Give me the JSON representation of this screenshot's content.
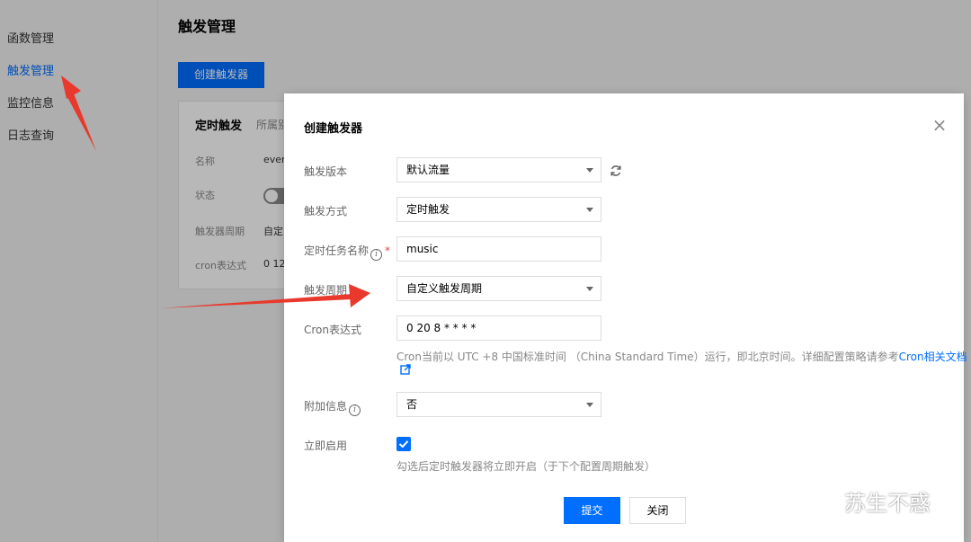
{
  "sidebar": {
    "items": [
      {
        "label": "函数管理",
        "active": false
      },
      {
        "label": "触发管理",
        "active": true
      },
      {
        "label": "监控信息",
        "active": false
      },
      {
        "label": "日志查询",
        "active": false
      }
    ]
  },
  "main": {
    "title": "触发管理",
    "create_button": "创建触发器",
    "card": {
      "title": "定时触发",
      "subtitle": "所属别",
      "rows": [
        {
          "label": "名称",
          "value": "ever"
        },
        {
          "label": "状态",
          "value": ""
        },
        {
          "label": "触发器周期",
          "value": "自定"
        },
        {
          "label": "cron表达式",
          "value": "0 12"
        }
      ]
    }
  },
  "modal": {
    "title": "创建触发器",
    "close_icon": "close-icon",
    "fields": {
      "version": {
        "label": "触发版本",
        "value": "默认流量"
      },
      "method": {
        "label": "触发方式",
        "value": "定时触发"
      },
      "task_name": {
        "label": "定时任务名称",
        "value": "music"
      },
      "period": {
        "label": "触发周期",
        "value": "自定义触发周期"
      },
      "cron": {
        "label": "Cron表达式",
        "value": "0 20 8 * * * *"
      },
      "extra": {
        "label": "附加信息",
        "value": "否"
      },
      "enable": {
        "label": "立即启用",
        "checked": true
      }
    },
    "cron_help": "Cron当前以 UTC +8 中国标准时间 （China Standard Time）运行，即北京时间。详细配置策略请参考",
    "cron_help_link": "Cron相关文档",
    "enable_help": "勾选后定时触发器将立即开启（于下个配置周期触发）",
    "submit_label": "提交",
    "cancel_label": "关闭"
  },
  "watermark": {
    "text": "苏生不惑"
  },
  "colors": {
    "primary": "#006eff",
    "annotation_arrow": "#e8392c"
  }
}
